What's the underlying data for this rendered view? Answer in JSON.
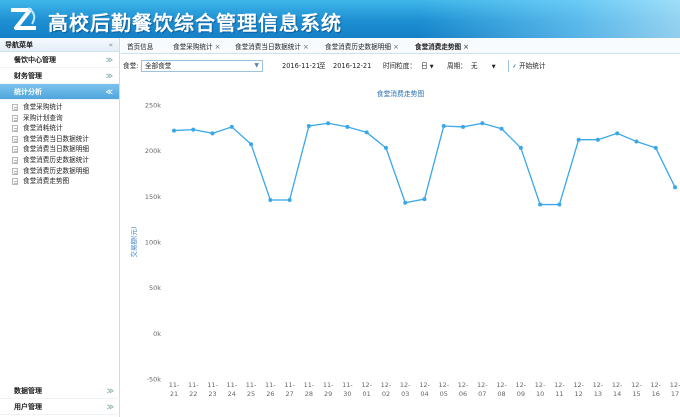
{
  "app": {
    "title": "高校后勤餐饮综合管理信息系统"
  },
  "sidebar": {
    "header": "导航菜单",
    "groups": [
      {
        "label": "餐饮中心管理"
      },
      {
        "label": "财务管理"
      },
      {
        "label": "统计分析"
      }
    ],
    "items": [
      {
        "label": "食堂采购统计"
      },
      {
        "label": "采购计划查询"
      },
      {
        "label": "食堂消耗统计"
      },
      {
        "label": "食堂消费当日数据统计"
      },
      {
        "label": "食堂消费当日数据明细"
      },
      {
        "label": "食堂消费历史数据统计"
      },
      {
        "label": "食堂消费历史数据明细"
      },
      {
        "label": "食堂消费走势图"
      }
    ],
    "bottom_groups": [
      {
        "label": "数据管理"
      },
      {
        "label": "用户管理"
      }
    ]
  },
  "tabs": [
    {
      "label": "首页信息",
      "closable": false
    },
    {
      "label": "食堂采购统计",
      "closable": true
    },
    {
      "label": "食堂消费当日数据统计",
      "closable": true
    },
    {
      "label": "食堂消费历史数据明细",
      "closable": true
    },
    {
      "label": "食堂消费走势图",
      "closable": true,
      "active": true
    }
  ],
  "filters": {
    "canteen_label": "食堂:",
    "canteen_value": "全部食堂",
    "date_from": "2016-11-21",
    "to_label": "至",
    "date_to": "2016-12-21",
    "granularity_label": "时间粒度：",
    "granularity_value": "日",
    "period_label": "周期：",
    "period_value": "无",
    "start_button": "开始统计"
  },
  "chart_data": {
    "type": "line",
    "title": "食堂消费走势图",
    "ylabel": "交易额(元)",
    "ylim": [
      -50000,
      250000
    ],
    "yticks": [
      "250k",
      "200k",
      "150k",
      "100k",
      "50k",
      "0k",
      "-50k"
    ],
    "x": [
      "11-21",
      "11-22",
      "11-23",
      "11-24",
      "11-25",
      "11-26",
      "11-27",
      "11-28",
      "11-29",
      "11-30",
      "12-01",
      "12-02",
      "12-03",
      "12-04",
      "12-05",
      "12-06",
      "12-07",
      "12-08",
      "12-09",
      "12-10",
      "12-11",
      "12-12",
      "12-13",
      "12-14",
      "12-15",
      "12-16",
      "12-17"
    ],
    "series": [
      {
        "values": [
          222000,
          223000,
          219000,
          226000,
          207000,
          146000,
          146000,
          227000,
          230000,
          226000,
          220000,
          203000,
          143000,
          147000,
          227000,
          226000,
          230000,
          224000,
          203000,
          141000,
          141000,
          212000,
          212000,
          219000,
          210000,
          203000,
          160000
        ]
      }
    ],
    "color": "#3aa7e8",
    "grid": false,
    "legend": "none"
  }
}
